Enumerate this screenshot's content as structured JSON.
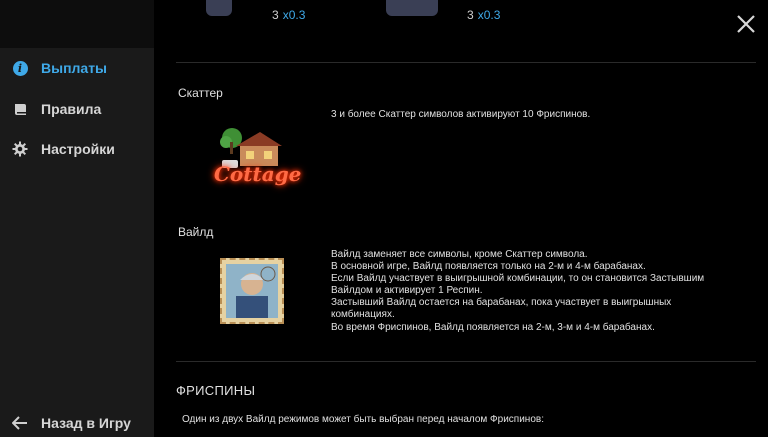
{
  "sidebar": {
    "items": [
      {
        "label": "Выплаты",
        "icon": "info-icon",
        "active": true
      },
      {
        "label": "Правила",
        "icon": "book-icon",
        "active": false
      },
      {
        "label": "Настройки",
        "icon": "gear-icon",
        "active": false
      }
    ],
    "back_label": "Назад в Игру"
  },
  "top_pays": [
    {
      "count": "3",
      "mult": "x0.3"
    },
    {
      "count": "3",
      "mult": "x0.3"
    }
  ],
  "scatter": {
    "title": "Скаттер",
    "logo_text": "Cottage",
    "description": "3 и более Скаттер символов активируют 10 Фриспинов."
  },
  "wild": {
    "title": "Вайлд",
    "lines": [
      "Вайлд заменяет все символы, кроме Скаттер символа.",
      "В основной игре, Вайлд появляется только на 2-м и 4-м барабанах.",
      "Если Вайлд участвует в выигрышной комбинации, то он становится Застывшим",
      "Вайлдом и активирует 1 Респин.",
      "Застывший Вайлд остается на барабанах, пока участвует в выигрышных",
      "комбинациях.",
      "Во время Фриспинов, Вайлд появляется на 2-м, 3-м и 4-м барабанах."
    ]
  },
  "freespins": {
    "title": "ФРИСПИНЫ",
    "text": "Один из двух Вайлд режимов может быть выбран перед началом Фриспинов:"
  },
  "colors": {
    "accent": "#3fa9e8",
    "sidebar_bg": "#1a1a1a",
    "main_bg": "#000000"
  }
}
